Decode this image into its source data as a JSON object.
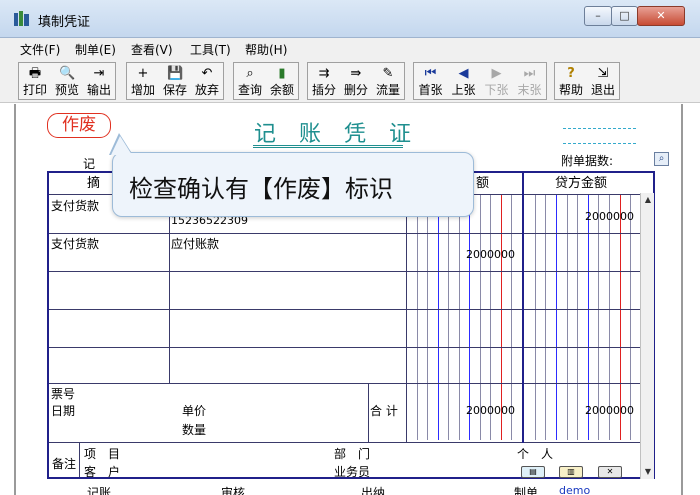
{
  "window": {
    "title": "填制凭证",
    "controls": {
      "minimize": "–",
      "maximize": "□",
      "close": "✕"
    }
  },
  "menu": [
    {
      "label": "文件(F)"
    },
    {
      "label": "制单(E)"
    },
    {
      "label": "查看(V)"
    },
    {
      "label": "工具(T)"
    },
    {
      "label": "帮助(H)"
    }
  ],
  "toolbar": {
    "buttons": [
      {
        "label": "打印",
        "icon": "print-icon",
        "glyph": "🖶",
        "enabled": true
      },
      {
        "label": "预览",
        "icon": "preview-icon",
        "glyph": "🔍",
        "enabled": true
      },
      {
        "label": "输出",
        "icon": "export-icon",
        "glyph": "⇥",
        "enabled": true
      },
      {
        "label": "增加",
        "icon": "add-icon",
        "glyph": "+",
        "enabled": true
      },
      {
        "label": "保存",
        "icon": "save-icon",
        "glyph": "💾",
        "enabled": true
      },
      {
        "label": "放弃",
        "icon": "undo-icon",
        "glyph": "↶",
        "enabled": true
      },
      {
        "label": "查询",
        "icon": "binoculars-icon",
        "glyph": "⌕",
        "enabled": true
      },
      {
        "label": "余额",
        "icon": "balance-chart-icon",
        "glyph": "▮",
        "enabled": true
      },
      {
        "label": "插分",
        "icon": "insert-line-icon",
        "glyph": "⇉",
        "enabled": true
      },
      {
        "label": "删分",
        "icon": "delete-line-icon",
        "glyph": "⇛",
        "enabled": true
      },
      {
        "label": "流量",
        "icon": "flow-icon",
        "glyph": "✎",
        "enabled": true
      },
      {
        "label": "首张",
        "icon": "first-icon",
        "glyph": "⏮",
        "enabled": true
      },
      {
        "label": "上张",
        "icon": "prev-icon",
        "glyph": "◀",
        "enabled": true
      },
      {
        "label": "下张",
        "icon": "next-icon",
        "glyph": "▶",
        "enabled": false
      },
      {
        "label": "末张",
        "icon": "last-icon",
        "glyph": "⏭",
        "enabled": false
      },
      {
        "label": "帮助",
        "icon": "help-icon",
        "glyph": "?",
        "enabled": true
      },
      {
        "label": "退出",
        "icon": "exit-icon",
        "glyph": "⇲",
        "enabled": true
      }
    ]
  },
  "voucher": {
    "void_stamp": "作废",
    "title": "记 账 凭 证",
    "type_label": "记",
    "attachments_label": "附单据数:",
    "columns": {
      "summary": "摘",
      "debit": "额",
      "credit": "贷方金额"
    },
    "rows": [
      {
        "summary": "支付货款",
        "account": "15236522309",
        "debit": "",
        "credit": "2000000"
      },
      {
        "summary": "支付货款",
        "account": "应付账款",
        "debit": "2000000",
        "credit": ""
      },
      {
        "summary": "",
        "account": "",
        "debit": "",
        "credit": ""
      },
      {
        "summary": "",
        "account": "",
        "debit": "",
        "credit": ""
      },
      {
        "summary": "",
        "account": "",
        "debit": "",
        "credit": ""
      }
    ],
    "bill_no_label": "票号",
    "date_label": "日期",
    "unit_price_label": "单价",
    "quantity_label": "数量",
    "total_label": "合 计",
    "total_debit": "2000000",
    "total_credit": "2000000",
    "remarks": {
      "label": "备注",
      "project": "项　目",
      "department": "部　门",
      "person": "个　人",
      "customer": "客　户",
      "salesperson": "业务员"
    },
    "footer": {
      "bookkeeper": "记账",
      "auditor": "审核",
      "cashier": "出纳",
      "maker_label": "制单",
      "maker_value": "demo"
    }
  },
  "tooltip": {
    "text": "检查确认有【作废】标识"
  },
  "colors": {
    "void": "#e03020",
    "title": "#1f8f8f",
    "grid_border": "#20208a",
    "amount_line_blue": "#2c2cff",
    "amount_line_red": "#e02020"
  }
}
